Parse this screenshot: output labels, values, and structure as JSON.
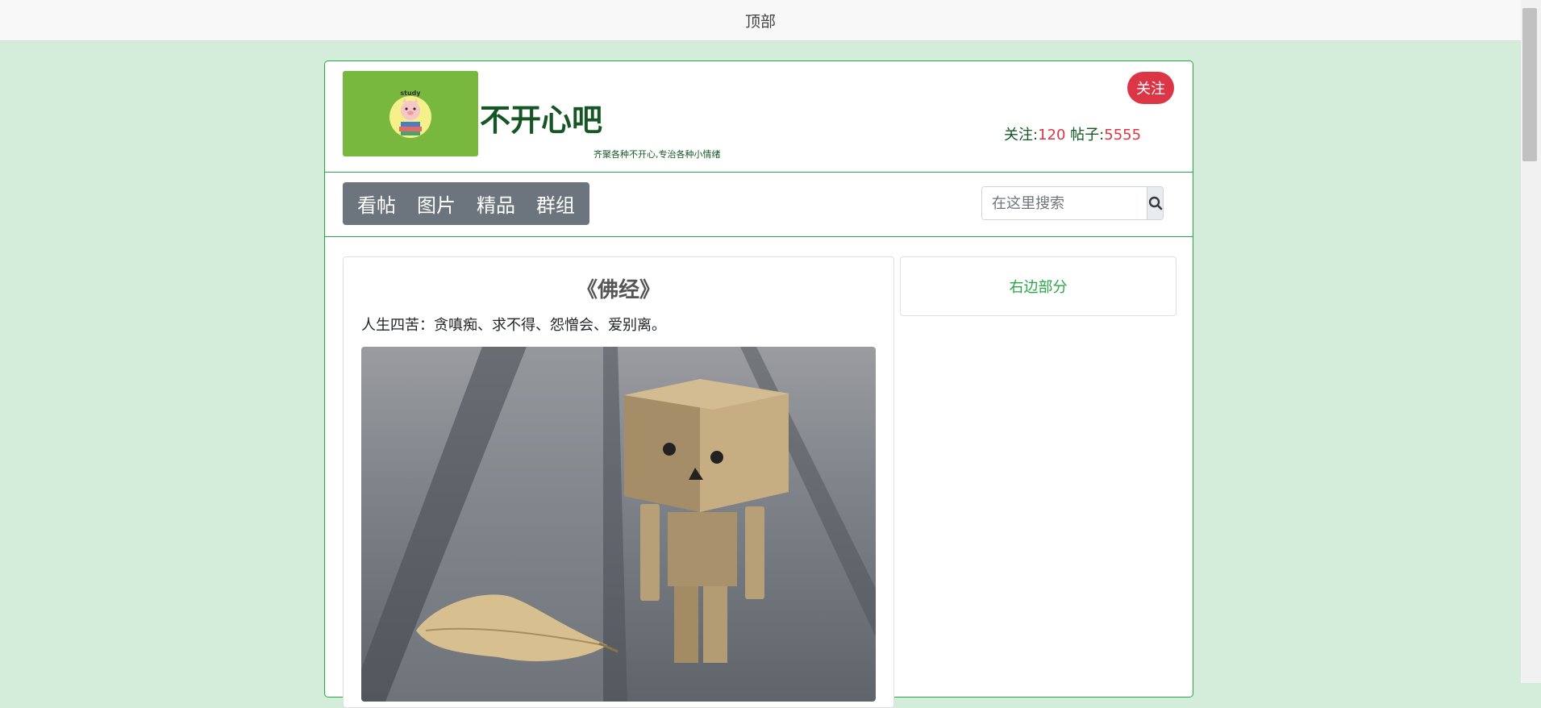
{
  "topbar": {
    "title": "顶部"
  },
  "header": {
    "logo_text": "study",
    "forum_name": "不开心吧",
    "tagline": "齐聚各种不开心,专治各种小情绪",
    "follow_label": "关注",
    "stats": {
      "follow_label": "关注:",
      "follow_count": "120",
      "posts_label": "帖子:",
      "posts_count": "5555"
    }
  },
  "nav": {
    "items": [
      {
        "label": "看帖"
      },
      {
        "label": "图片"
      },
      {
        "label": "精品"
      },
      {
        "label": "群组"
      }
    ]
  },
  "search": {
    "placeholder": "在这里搜索",
    "icon": "search-icon"
  },
  "post": {
    "title": "《佛经》",
    "body": "人生四苦：贪嗔痴、求不得、怨憎会、爱别离。"
  },
  "sidebar": {
    "label": "右边部分"
  },
  "colors": {
    "page_bg": "#d4edda",
    "accent_green": "#28a745",
    "title_green": "#155724",
    "follow_red": "#dc3545",
    "nav_gray": "#6c757d",
    "logo_bg": "#79b83e"
  }
}
